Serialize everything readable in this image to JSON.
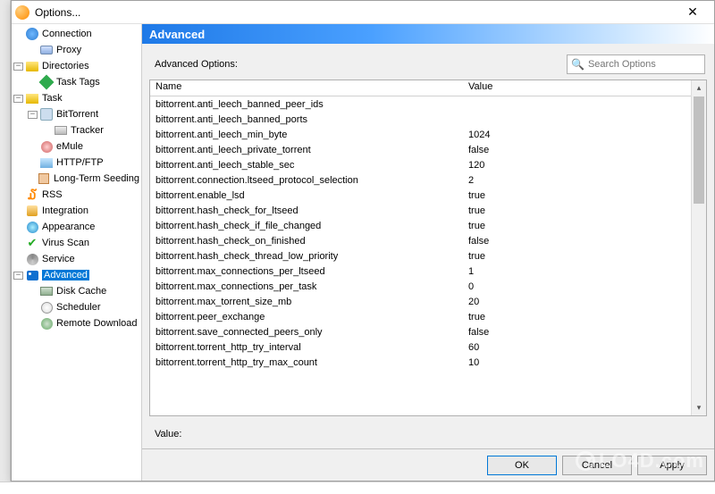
{
  "window": {
    "title": "Options...",
    "close_glyph": "✕"
  },
  "sidebar": {
    "items": [
      {
        "label": "Connection",
        "level": 0,
        "icon": "ic-globe"
      },
      {
        "label": "Proxy",
        "level": 1,
        "icon": "ic-server"
      },
      {
        "label": "Directories",
        "level": 0,
        "icon": "ic-folder",
        "expander": "−"
      },
      {
        "label": "Task Tags",
        "level": 1,
        "icon": "ic-tag"
      },
      {
        "label": "Task",
        "level": 0,
        "icon": "ic-task",
        "expander": "−"
      },
      {
        "label": "BitTorrent",
        "level": 1,
        "icon": "ic-bt",
        "expander": "−"
      },
      {
        "label": "Tracker",
        "level": 2,
        "icon": "ic-tracker"
      },
      {
        "label": "eMule",
        "level": 1,
        "icon": "ic-emule"
      },
      {
        "label": "HTTP/FTP",
        "level": 1,
        "icon": "ic-http"
      },
      {
        "label": "Long-Term Seeding",
        "level": 1,
        "icon": "ic-ltseed"
      },
      {
        "label": "RSS",
        "level": 0,
        "icon": "ic-rss",
        "glyph": "໓"
      },
      {
        "label": "Integration",
        "level": 0,
        "icon": "ic-int"
      },
      {
        "label": "Appearance",
        "level": 0,
        "icon": "ic-appear"
      },
      {
        "label": "Virus Scan",
        "level": 0,
        "icon": "ic-virus",
        "glyph": "✔"
      },
      {
        "label": "Service",
        "level": 0,
        "icon": "ic-service"
      },
      {
        "label": "Advanced",
        "level": 0,
        "icon": "ic-adv",
        "expander": "−",
        "selected": true
      },
      {
        "label": "Disk Cache",
        "level": 1,
        "icon": "ic-disk"
      },
      {
        "label": "Scheduler",
        "level": 1,
        "icon": "ic-sched"
      },
      {
        "label": "Remote Download",
        "level": 1,
        "icon": "ic-remote"
      }
    ]
  },
  "content": {
    "header": "Advanced",
    "options_label": "Advanced Options:",
    "search_placeholder": "Search Options",
    "columns": {
      "name": "Name",
      "value": "Value"
    },
    "rows": [
      {
        "name": "bittorrent.anti_leech_banned_peer_ids",
        "value": ""
      },
      {
        "name": "bittorrent.anti_leech_banned_ports",
        "value": ""
      },
      {
        "name": "bittorrent.anti_leech_min_byte",
        "value": "1024"
      },
      {
        "name": "bittorrent.anti_leech_private_torrent",
        "value": "false"
      },
      {
        "name": "bittorrent.anti_leech_stable_sec",
        "value": "120"
      },
      {
        "name": "bittorrent.connection.ltseed_protocol_selection",
        "value": "2"
      },
      {
        "name": "bittorrent.enable_lsd",
        "value": "true"
      },
      {
        "name": "bittorrent.hash_check_for_ltseed",
        "value": "true"
      },
      {
        "name": "bittorrent.hash_check_if_file_changed",
        "value": "true"
      },
      {
        "name": "bittorrent.hash_check_on_finished",
        "value": "false"
      },
      {
        "name": "bittorrent.hash_check_thread_low_priority",
        "value": "true"
      },
      {
        "name": "bittorrent.max_connections_per_ltseed",
        "value": "1"
      },
      {
        "name": "bittorrent.max_connections_per_task",
        "value": "0"
      },
      {
        "name": "bittorrent.max_torrent_size_mb",
        "value": "20"
      },
      {
        "name": "bittorrent.peer_exchange",
        "value": "true"
      },
      {
        "name": "bittorrent.save_connected_peers_only",
        "value": "false"
      },
      {
        "name": "bittorrent.torrent_http_try_interval",
        "value": "60"
      },
      {
        "name": "bittorrent.torrent_http_try_max_count",
        "value": "10"
      }
    ],
    "value_label": "Value:"
  },
  "buttons": {
    "ok": "OK",
    "cancel": "Cancel",
    "apply": "Apply"
  },
  "watermark": "LO4D.com"
}
